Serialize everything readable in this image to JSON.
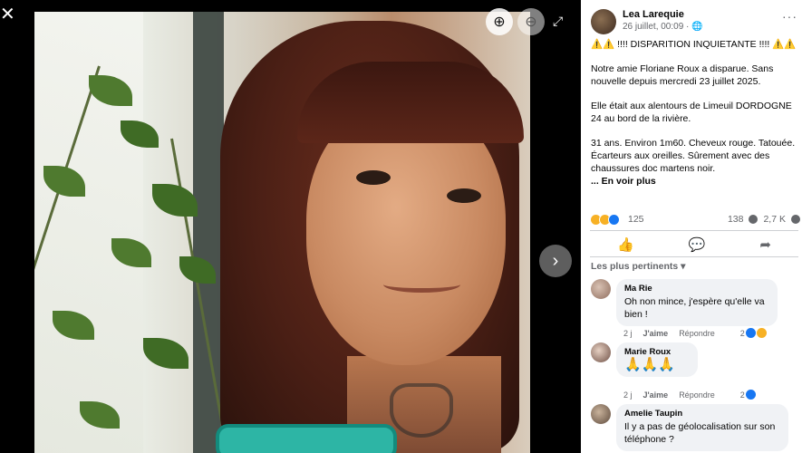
{
  "viewer": {
    "close_glyph": "✕",
    "zoom_in_glyph": "⊕",
    "zoom_out_glyph": "⊖",
    "expand_glyph": "⤢",
    "next_glyph": "›",
    "icons": [
      "close-icon",
      "zoom-in-icon",
      "zoom-out-icon",
      "expand-icon",
      "chevron-right-icon"
    ]
  },
  "post": {
    "author": "Lea Larequie",
    "date": "26 juillet, 00:09 · ",
    "audience_icon": "globe-icon",
    "more_glyph": "···",
    "paragraphs": [
      "⚠️⚠️ !!!! DISPARITION INQUIETANTE !!!! ⚠️⚠️",
      "Notre amie Floriane Roux a disparue. Sans nouvelle depuis mercredi 23 juillet 2025.",
      "Elle était aux alentours de Limeuil DORDOGNE 24 au bord de la rivière.",
      "31 ans. Environ 1m60. Cheveux rouge. Tatouée. Écarteurs aux oreilles. Sûrement avec des chaussures doc martens noir."
    ],
    "see_more": "... En voir plus",
    "reaction_count": "125",
    "comment_count": "138",
    "share_count": "2,7 K"
  },
  "actions": {
    "like_glyph": "👍",
    "comment_glyph": "💬",
    "share_glyph": "➦"
  },
  "comments_sort": "Les plus pertinents ▾",
  "comments": [
    {
      "name": "Ma Rie",
      "text": "Oh non mince, j'espère qu'elle va bien !",
      "time": "2 j",
      "like": "J'aime",
      "reply": "Répondre",
      "reacts": "2"
    },
    {
      "name": "Marie Roux",
      "text": "🙏🙏🙏",
      "time": "2 j",
      "like": "J'aime",
      "reply": "Répondre",
      "reacts": "2"
    },
    {
      "name": "Amelie Taupin",
      "text": "Il y a pas de géolocalisation sur son téléphone ?",
      "time": "",
      "like": "",
      "reply": "",
      "reacts": ""
    }
  ],
  "colors": {
    "accent": "#1877f2",
    "muted": "#65676b",
    "bubble": "#f0f2f5"
  }
}
